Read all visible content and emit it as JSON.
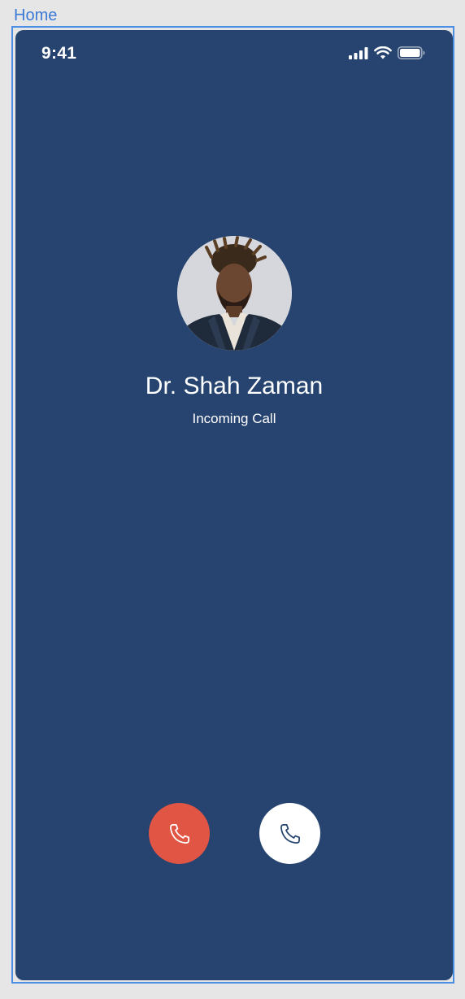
{
  "frame": {
    "label": "Home"
  },
  "status_bar": {
    "time": "9:41",
    "icons": [
      "signal-icon",
      "wifi-icon",
      "battery-icon"
    ]
  },
  "caller": {
    "name": "Dr. Shah Zaman",
    "status": "Incoming Call"
  },
  "actions": {
    "decline": {
      "icon": "phone-icon",
      "color": "#e15545"
    },
    "accept": {
      "icon": "phone-icon",
      "color": "#ffffff"
    }
  },
  "colors": {
    "background": "#26446f",
    "frame_outline": "#4a8fe3",
    "frame_label": "#3b7ad6"
  }
}
